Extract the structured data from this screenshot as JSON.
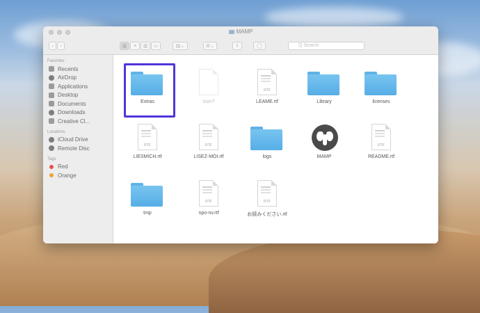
{
  "window": {
    "title": "MAMP"
  },
  "toolbar": {
    "search_placeholder": "Q Search"
  },
  "sidebar": {
    "favorites_header": "Favorites",
    "favorites": [
      {
        "label": "Recents",
        "icon": "clock-icon"
      },
      {
        "label": "AirDrop",
        "icon": "airdrop-icon"
      },
      {
        "label": "Applications",
        "icon": "applications-icon"
      },
      {
        "label": "Desktop",
        "icon": "desktop-icon"
      },
      {
        "label": "Documents",
        "icon": "documents-icon"
      },
      {
        "label": "Downloads",
        "icon": "downloads-icon"
      },
      {
        "label": "Creative Cl...",
        "icon": "folder-icon"
      }
    ],
    "locations_header": "Locations",
    "locations": [
      {
        "label": "iCloud Drive",
        "icon": "cloud-icon"
      },
      {
        "label": "Remote Disc",
        "icon": "disc-icon"
      }
    ],
    "tags_header": "Tags",
    "tags": [
      {
        "label": "Red",
        "color": "#e8534b"
      },
      {
        "label": "Orange",
        "color": "#f0a13a"
      }
    ]
  },
  "files": [
    {
      "label": "Extras",
      "type": "folder",
      "selected": true
    },
    {
      "label": "Icon?",
      "type": "doc-faded",
      "ext": ""
    },
    {
      "label": "LEAME.rtf",
      "type": "doc",
      "ext": "RTF"
    },
    {
      "label": "Library",
      "type": "folder"
    },
    {
      "label": "licenses",
      "type": "folder"
    },
    {
      "label": "LIESMICH.rtf",
      "type": "doc",
      "ext": "RTF"
    },
    {
      "label": "LISEZ-MOI.rtf",
      "type": "doc",
      "ext": "RTF"
    },
    {
      "label": "logs",
      "type": "folder"
    },
    {
      "label": "MAMP",
      "type": "app"
    },
    {
      "label": "README.rtf",
      "type": "doc",
      "ext": "RTF"
    },
    {
      "label": "tmp",
      "type": "folder"
    },
    {
      "label": "npo-nv.rtf",
      "type": "doc",
      "ext": "RTF"
    },
    {
      "label": "お読みください.rtf",
      "type": "doc",
      "ext": "RTF"
    }
  ]
}
